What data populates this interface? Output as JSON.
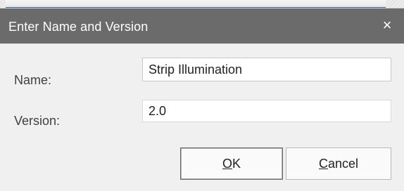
{
  "dialog": {
    "title": "Enter Name and Version",
    "close_glyph": "×"
  },
  "fields": {
    "name_label": "Name:",
    "name_value": "Strip Illumination",
    "version_label": "Version:",
    "version_value": "2.0"
  },
  "buttons": {
    "ok_mnemonic": "O",
    "ok_rest": "K",
    "cancel_mnemonic": "C",
    "cancel_rest": "ancel"
  },
  "icons": {
    "close": "close-icon"
  },
  "colors": {
    "titlebar": "#6b6b6b",
    "dialog_bg": "#f0f0f0",
    "accent_line": "#2f5ea8"
  }
}
